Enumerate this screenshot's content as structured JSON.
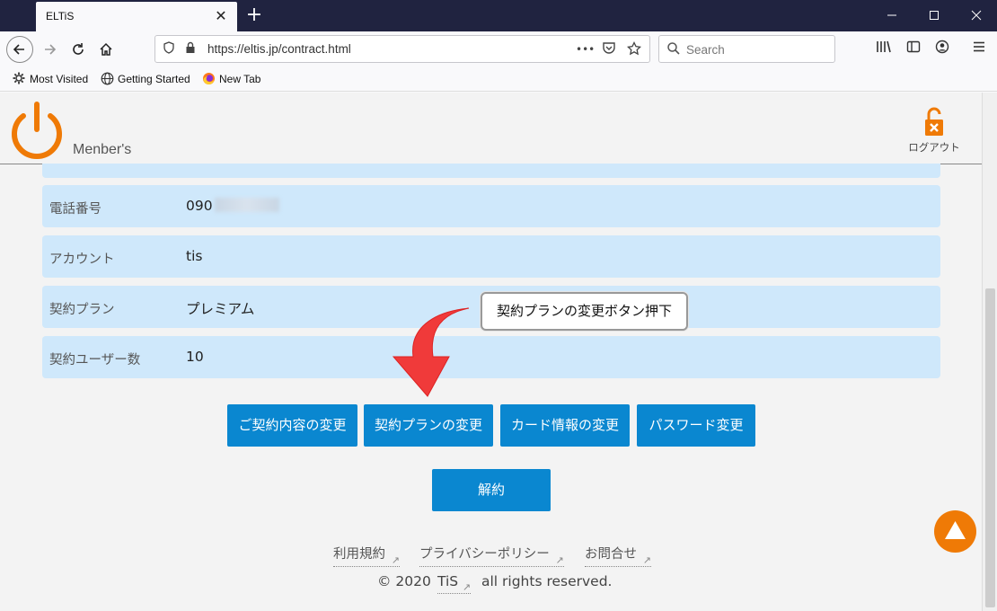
{
  "browser": {
    "tab_title": "ELTiS",
    "tab_close": "✕",
    "new_tab": "+",
    "url": "https://eltis.jp/contract.html",
    "url_more": "•••",
    "search_placeholder": "Search",
    "bookmarks": [
      {
        "label": "Most Visited",
        "icon": "gear-icon"
      },
      {
        "label": "Getting Started",
        "icon": "globe-icon"
      },
      {
        "label": "New Tab",
        "icon": "firefox-icon"
      }
    ]
  },
  "header": {
    "brand_sub": "Menber's",
    "logout_label": "ログアウト",
    "accent_color": "#ef7a06"
  },
  "contract": {
    "rows": [
      {
        "label": "電話番号",
        "value": "090"
      },
      {
        "label": "アカウント",
        "value": "tis"
      },
      {
        "label": "契約プラン",
        "value": "プレミアム"
      },
      {
        "label": "契約ユーザー数",
        "value": "10"
      }
    ]
  },
  "callout": {
    "text": "契約プランの変更ボタン押下",
    "arrow_color": "#f03a3a"
  },
  "actions": {
    "change_contract": "ご契約内容の変更",
    "change_plan": "契約プランの変更",
    "change_card": "カード情報の変更",
    "change_password": "パスワード変更",
    "cancel": "解約",
    "button_color": "#0a87d0"
  },
  "footer": {
    "links": [
      "利用規約",
      "プライバシーポリシー",
      "お問合せ"
    ],
    "copyright_prefix": "© 2020",
    "copyright_brand": "TiS",
    "copyright_suffix": "all rights reserved."
  }
}
